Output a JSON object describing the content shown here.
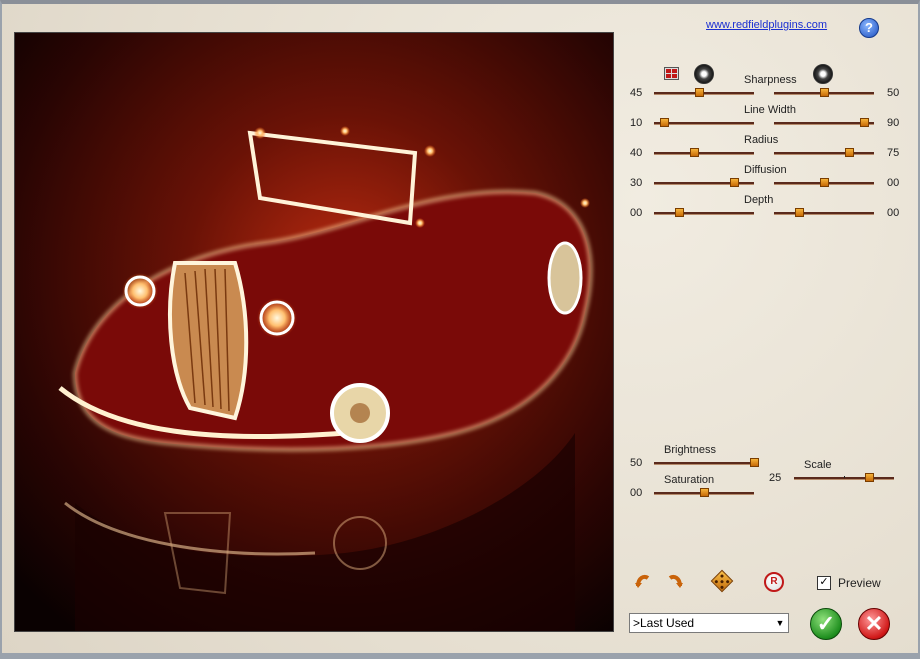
{
  "header": {
    "link_text": "www.redfieldplugins.com",
    "help_label": "?"
  },
  "sliders_top": {
    "heading": "Sharpness",
    "rows": [
      {
        "label": "Sharpness",
        "left_value": "45",
        "right_value": "50",
        "left_pos": 0.45,
        "right_pos": 0.5
      },
      {
        "label": "Line Width",
        "left_value": "10",
        "right_value": "90",
        "left_pos": 0.1,
        "right_pos": 0.9
      },
      {
        "label": "Radius",
        "left_value": "40",
        "right_value": "75",
        "left_pos": 0.4,
        "right_pos": 0.75
      },
      {
        "label": "Diffusion",
        "left_value": "30",
        "right_value": "00",
        "left_pos": 0.8,
        "right_pos": 0.5
      },
      {
        "label": "Depth",
        "left_value": "00",
        "right_value": "00",
        "left_pos": 0.25,
        "right_pos": 0.25
      }
    ]
  },
  "sliders_bottom": {
    "brightness": {
      "label": "Brightness",
      "value": "50",
      "pos": 1.0
    },
    "saturation": {
      "label": "Saturation",
      "value": "00",
      "pos": 0.5
    },
    "scale": {
      "label": "Scale",
      "value": "25",
      "pos": 0.75
    }
  },
  "footer": {
    "preview_label": "Preview",
    "preview_checked": "✓",
    "preset_selected": ">Last Used",
    "reset_label": "R",
    "ok_glyph": "✓",
    "cancel_glyph": "✕"
  },
  "colors": {
    "accent": "#e08a12",
    "track": "#5a2a1c",
    "ok": "#1f8f1f",
    "cancel": "#d01818"
  },
  "icons": [
    "grid-icon",
    "starburst-icon",
    "undo-icon",
    "redo-icon",
    "random-dice-icon",
    "reset-icon",
    "ok-check-icon",
    "cancel-x-icon",
    "help-icon"
  ]
}
